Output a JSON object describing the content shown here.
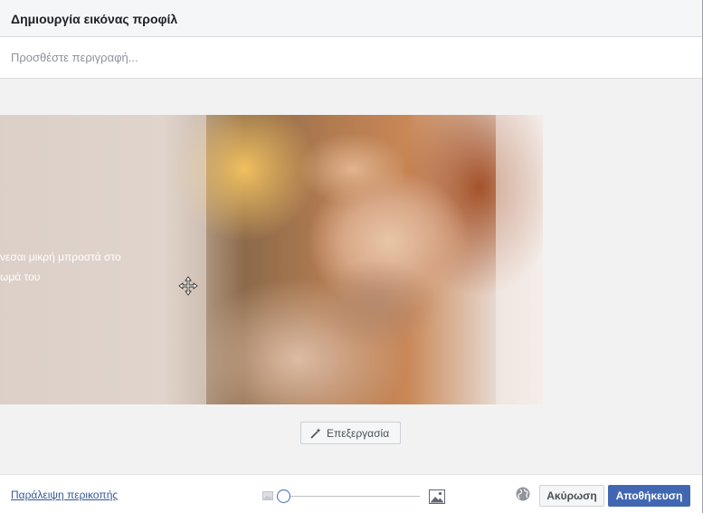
{
  "header": {
    "title": "Δημιουργία εικόνας προφίλ"
  },
  "description": {
    "placeholder": "Προσθέστε περιγραφή..."
  },
  "photo": {
    "overlay_lines": [
      "νεσαι μικρή μπροστά στο",
      "ωμά του"
    ]
  },
  "edit_button": {
    "label": "Επεξεργασία",
    "icon": "magic-wand-icon"
  },
  "footer": {
    "skip_crop": "Παράλειψη περικοπής",
    "zoom_level": 0.0,
    "cancel_label": "Ακύρωση",
    "save_label": "Αποθήκευση",
    "privacy_icon": "globe-icon"
  },
  "colors": {
    "primary": "#4267b2",
    "link": "#365899",
    "header_bg": "#f5f6f7"
  }
}
